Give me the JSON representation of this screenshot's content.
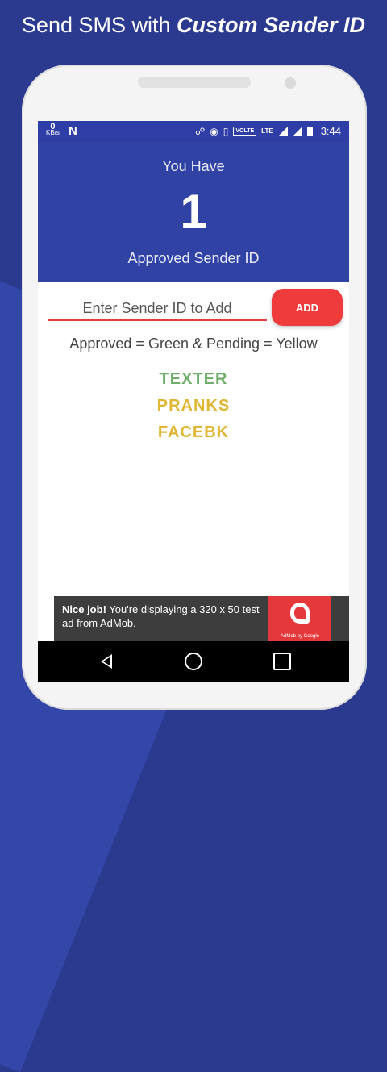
{
  "headline": {
    "prefix": "Send SMS with ",
    "emphasis": "Custom Sender ID"
  },
  "status_bar": {
    "speed_value": "0",
    "speed_unit": "KB/s",
    "n_icon": "N",
    "volte": "VOLTE",
    "lte": "LTE",
    "time": "3:44",
    "icons": [
      "headphones-icon",
      "hotspot-icon",
      "vibrate-icon",
      "signal-icon",
      "signal-icon",
      "battery-icon"
    ]
  },
  "hero": {
    "you_have": "You Have",
    "count": "1",
    "approved_label": "Approved Sender ID",
    "color": "#3042a4"
  },
  "form": {
    "placeholder": "Enter Sender ID to Add",
    "value": "",
    "add_label": "ADD",
    "accent": "#ef3b3b"
  },
  "legend": "Approved = Green & Pending = Yellow",
  "senders": [
    {
      "name": "TEXTER",
      "status": "approved",
      "color": "#6fae6a"
    },
    {
      "name": "PRANKS",
      "status": "pending",
      "color": "#e0b735"
    },
    {
      "name": "FACEBK",
      "status": "pending",
      "color": "#e0b735"
    }
  ],
  "ad": {
    "bold": "Nice job!",
    "text": " You're displaying a 320 x 50 test ad from AdMob.",
    "logo_caption": "AdMob by Google"
  },
  "navbar": {
    "icons": [
      "back-icon",
      "home-icon",
      "recents-icon"
    ]
  }
}
